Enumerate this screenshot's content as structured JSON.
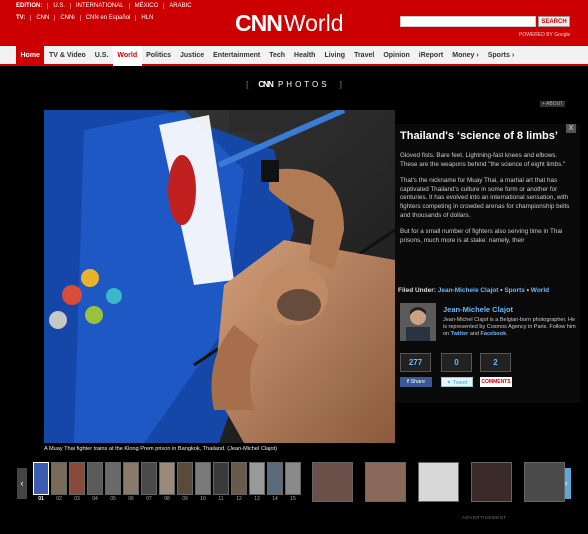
{
  "header": {
    "edition_label": "EDITION:",
    "editions": [
      "U.S.",
      "INTERNATIONAL",
      "MÉXICO",
      "ARABIC"
    ],
    "tv_label": "TV:",
    "tv_channels": [
      "CNN",
      "CNNi",
      "CNN en Español",
      "HLN"
    ],
    "logo_cnn": "CNN",
    "logo_world": "World",
    "search_button": "SEARCH",
    "powered_by": "POWERED BY Google"
  },
  "nav": {
    "items": [
      "Home",
      "TV & Video",
      "U.S.",
      "World",
      "Politics",
      "Justice",
      "Entertainment",
      "Tech",
      "Health",
      "Living",
      "Travel",
      "Opinion",
      "iReport",
      "Money ›",
      "Sports ›"
    ],
    "active": "World"
  },
  "section": {
    "open_bracket": "[",
    "cnn": "CNN",
    "label": "PHOTOS",
    "close_bracket": "]",
    "about": "+ ABOUT"
  },
  "article": {
    "close": "X",
    "title": "Thailand's ‘science of 8 limbs’",
    "paragraphs": [
      "Gloved fists. Bare feet. Lightning-fast knees and elbows. These are the weapons behind \"the science of eight limbs.\"",
      "That's the nickname for Muay Thai, a martial art that has captivated Thailand's culture in some form or another for centuries. It has evolved into an international sensation, with fighters competing in crowded arenas for championship belts and thousands of dollars.",
      "But for a small number of fighters also serving time in Thai prisons, much more is at stake: namely, their"
    ],
    "filed_label": "Filed Under:",
    "filed_author": "Jean-Michele Clajot",
    "filed_sep1": " • ",
    "filed_sports": "Sports",
    "filed_sep2": " • ",
    "filed_world": "World",
    "author_name": "Jean-Michele Clajot",
    "author_bio_1": "Jean-Michel Clajot is a Belgian-born photographer. He is represented by Cosmos Agency in Paris. Follow him on",
    "author_bio_twitter": "Twitter",
    "author_bio_and": "and",
    "author_bio_facebook": "Facebook",
    "author_bio_end": ".",
    "counts": [
      "277",
      "0",
      "2"
    ],
    "share_label": "Share",
    "tweet_label": "Tweet",
    "comments_label": "COMMENTS"
  },
  "caption": "A Muay Thai fighter trains at the Klong Prem prison in Bangkok, Thailand. (Jean-Michel Clajot)",
  "filmstrip": {
    "prev": "‹",
    "next": "›",
    "numbers": [
      "01",
      "02",
      "03",
      "04",
      "05",
      "06",
      "07",
      "08",
      "09",
      "10",
      "11",
      "12",
      "13",
      "14",
      "15"
    ],
    "selected": "01"
  },
  "advertisement": "ADVERTISEMENT",
  "colors": {
    "brand_red": "#cc0000",
    "link_blue": "#6bb8ff",
    "facebook_blue": "#3b5998",
    "twitter_blue": "#2fa4e7"
  }
}
